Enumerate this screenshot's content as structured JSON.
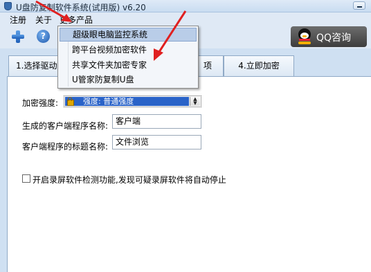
{
  "window": {
    "title": "U盘防复制软件系统(试用版) v6.20"
  },
  "menubar": {
    "items": [
      "注册",
      "关于",
      "更多产品"
    ]
  },
  "dropdown": {
    "items": [
      "超级眼电脑监控系统",
      "跨平台视频加密软件",
      "共享文件夹加密专家",
      "U管家防复制U盘"
    ],
    "highlighted_index": 0
  },
  "toolbar": {
    "add_icon": "plus-icon",
    "help_icon": "help-icon",
    "help_glyph": "?",
    "qq_label": "QQ咨询"
  },
  "tabs": {
    "tab1_label": "1.选择驱动",
    "tab3_label": "项",
    "tab4_label": "4.立即加密"
  },
  "form": {
    "strength_label": "加密强度:",
    "strength_value": "强度: 普通强度",
    "client_name_label": "生成的客户端程序名称:",
    "client_name_value": "客户端",
    "client_title_label": "客户端程序的标题名称:",
    "client_title_value": "文件浏览",
    "screen_record_label": "开启录屏软件检测功能,发现可疑录屏软件将自动停止",
    "screen_record_checked": false
  },
  "colors": {
    "selection": "#2a63c8",
    "annotation_arrow": "#e02020",
    "menu_highlight": "#b9cde8"
  }
}
